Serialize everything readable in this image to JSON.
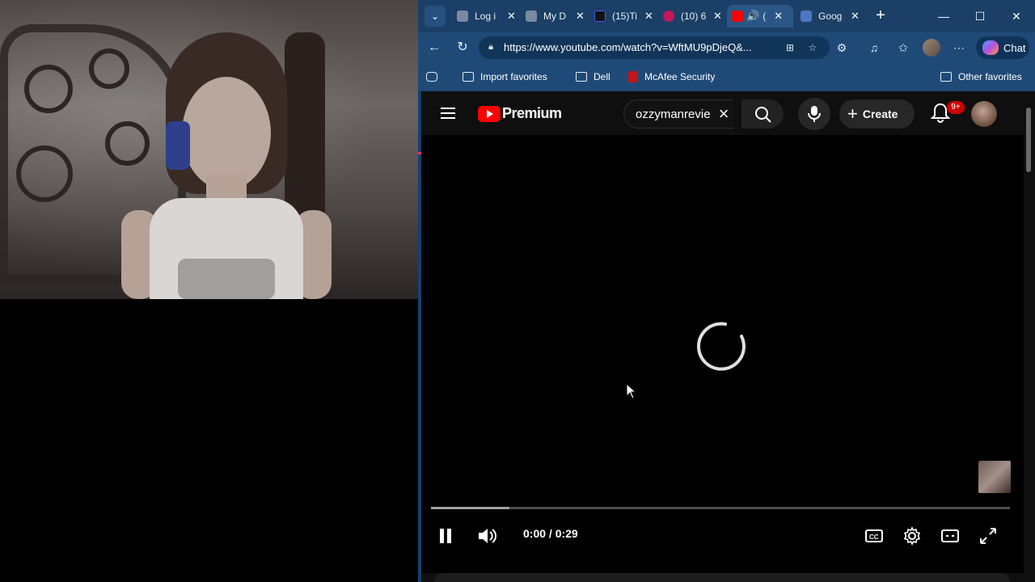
{
  "browser": {
    "tabs": [
      {
        "label": "Log i",
        "icon": "page-icon",
        "color": "#7a8aa0"
      },
      {
        "label": "My D",
        "icon": "page-icon",
        "color": "#7a8aa0"
      },
      {
        "label": "(15)Ti",
        "icon": "tiktok-icon",
        "color": "#111111"
      },
      {
        "label": "(10) 6",
        "icon": "video-icon",
        "color": "#c2185b"
      },
      {
        "label": "(",
        "icon": "youtube-icon",
        "color": "#ff0000",
        "active": true
      },
      {
        "label": "Goog",
        "icon": "docs-icon",
        "color": "#4a78c2"
      }
    ],
    "close_glyph": "✕",
    "new_tab_glyph": "+",
    "window": {
      "minimize": "—",
      "maximize": "☐",
      "close": "✕"
    },
    "url": "https://www.youtube.com/watch?v=WftMU9pDjeQ&...",
    "chat_label": "Chat",
    "favorites": {
      "import": "Import favorites",
      "dell": "Dell",
      "mcafee": "McAfee Security",
      "other": "Other favorites"
    }
  },
  "youtube": {
    "brand": "Premium",
    "search_value": "ozzymanrevie",
    "create_label": "Create",
    "notifications_badge": "9+",
    "time_display": "0:00 / 0:29",
    "buffer_fraction": 0.135
  },
  "colors": {
    "accent_red": "#ff0000",
    "tab_loading": "#e8325f",
    "browser_chrome": "#1f4a78"
  }
}
